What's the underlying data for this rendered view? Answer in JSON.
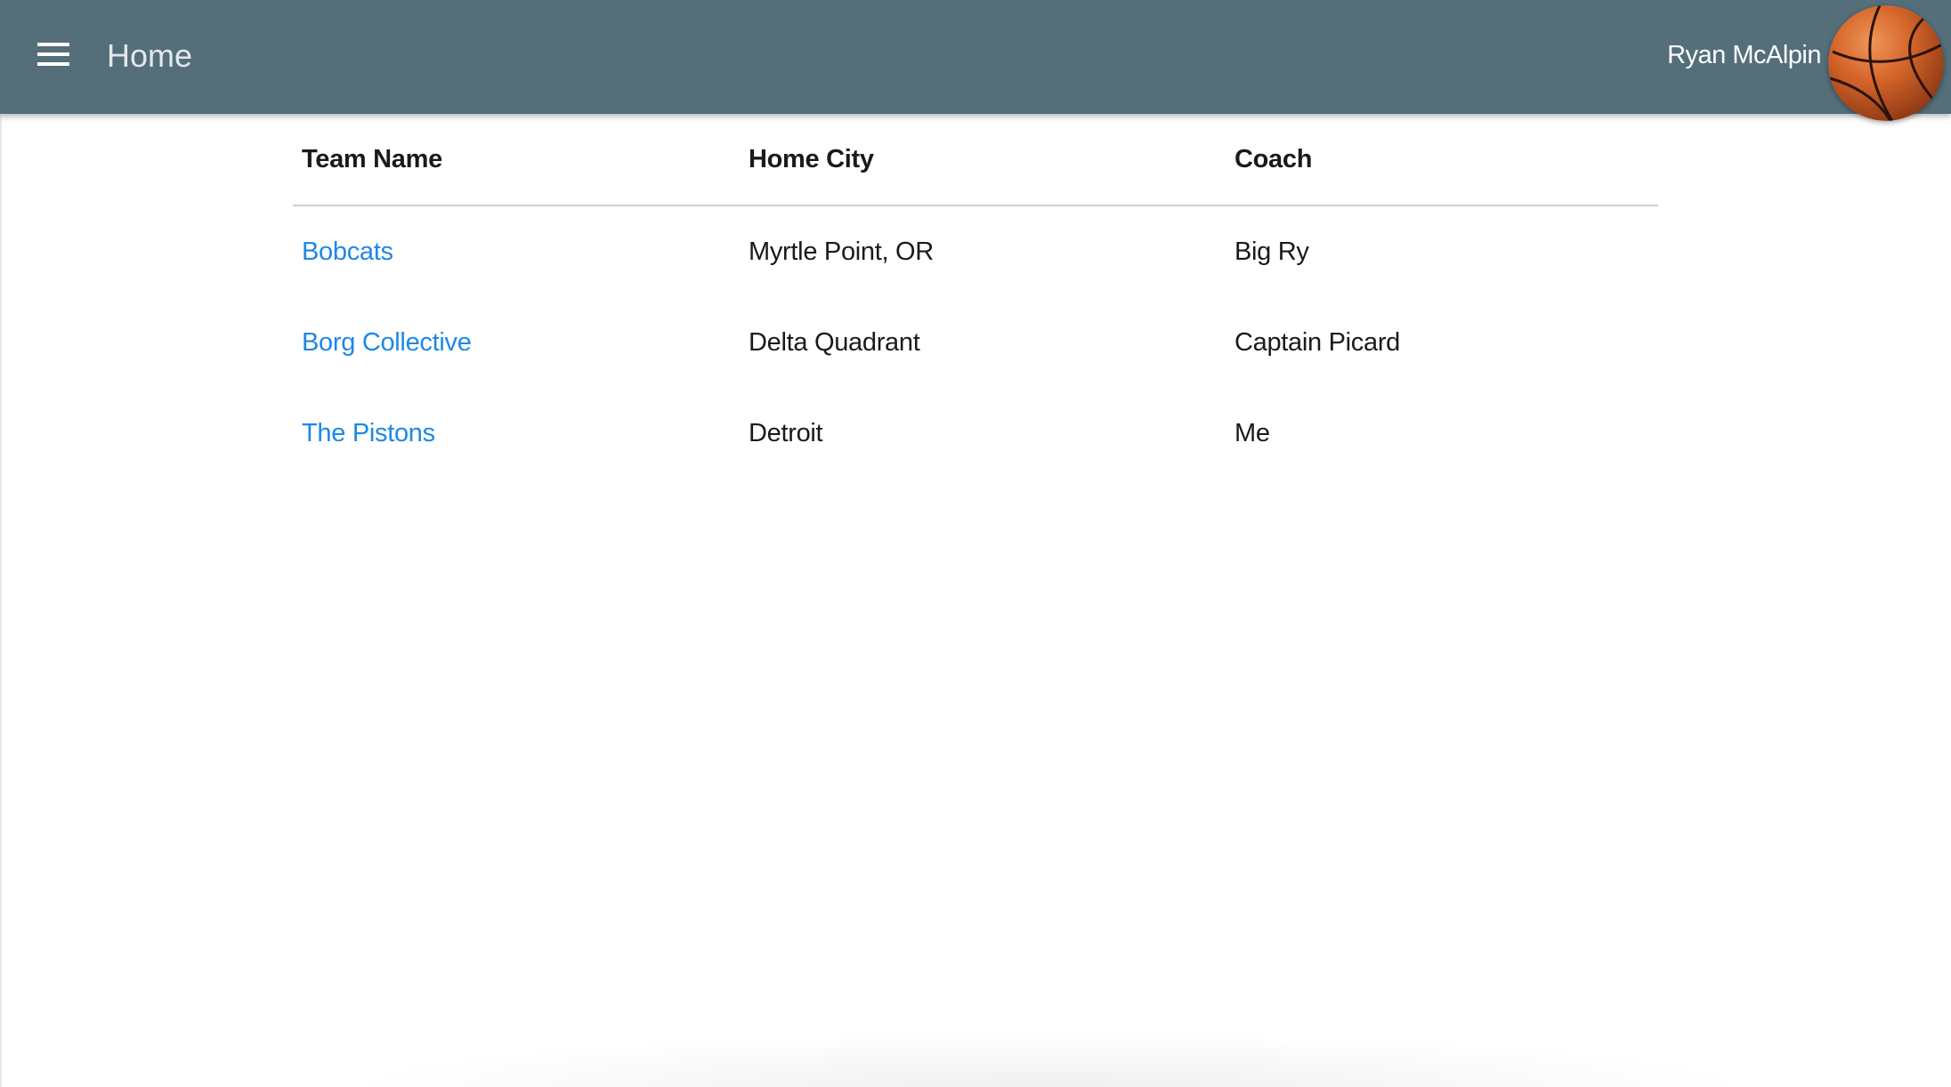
{
  "appbar": {
    "title": "Home",
    "menu_icon": "hamburger-menu-icon",
    "user_name": "Ryan McAlpin",
    "avatar_icon": "basketball-icon",
    "background_color": "#546e7a"
  },
  "table": {
    "columns": [
      "Team Name",
      "Home City",
      "Coach"
    ],
    "rows": [
      {
        "team": "Bobcats",
        "city": "Myrtle Point, OR",
        "coach": "Big Ry"
      },
      {
        "team": "Borg Collective",
        "city": "Delta Quadrant",
        "coach": "Captain Picard"
      },
      {
        "team": "The Pistons",
        "city": "Detroit",
        "coach": "Me"
      }
    ],
    "link_color": "#1e88e5"
  }
}
